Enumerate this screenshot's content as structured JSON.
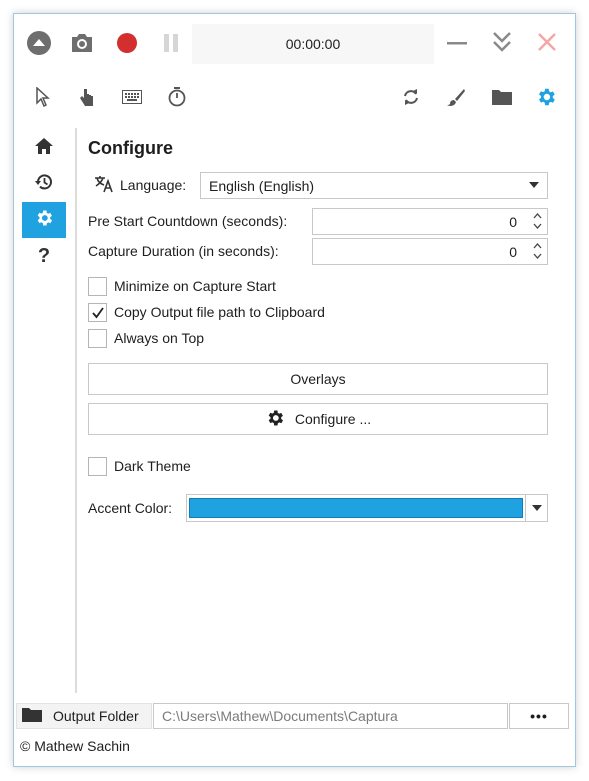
{
  "top": {
    "timer": "00:00:00",
    "icons": [
      "collapse-icon",
      "camera-icon",
      "record-icon",
      "pause-icon",
      "minimize-icon",
      "expand-icon",
      "close-icon"
    ]
  },
  "tools": {
    "left_icons": [
      "pointer-icon",
      "hand-icon",
      "keyboard-icon",
      "stopwatch-icon"
    ],
    "right_icons": [
      "refresh-icon",
      "brush-icon",
      "folder-icon",
      "gear-icon"
    ]
  },
  "sidenav": {
    "items": [
      "home-icon",
      "history-icon",
      "gear-icon",
      "help-icon"
    ],
    "active_index": 2
  },
  "configure": {
    "title": "Configure",
    "language_label": "Language:",
    "language_value": "English (English)",
    "countdown_label": "Pre Start Countdown (seconds):",
    "countdown_value": "0",
    "duration_label": "Capture Duration (in seconds):",
    "duration_value": "0",
    "checkboxes": [
      {
        "label": "Minimize on Capture Start",
        "checked": false
      },
      {
        "label": "Copy Output file path to Clipboard",
        "checked": true
      },
      {
        "label": "Always on Top",
        "checked": false
      }
    ],
    "overlays_button": "Overlays",
    "configure_button": "Configure ...",
    "dark_theme_label": "Dark Theme",
    "dark_theme_checked": false,
    "accent_label": "Accent Color:",
    "accent_color": "#1fa2df"
  },
  "bottom": {
    "output_folder_label": "Output Folder",
    "path": "C:\\Users\\Mathew\\Documents\\Captura",
    "more_label": "•••"
  },
  "footer": {
    "copyright": "© Mathew Sachin"
  },
  "colors": {
    "accent": "#1fa2df",
    "record": "#d32f2f",
    "close": "#f4a7a7",
    "icon": "#555555"
  }
}
